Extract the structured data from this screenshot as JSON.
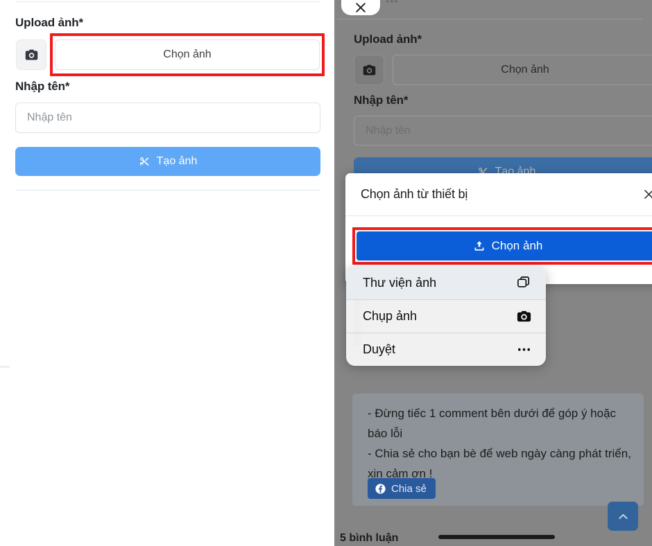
{
  "left_panel": {
    "upload_label": "Upload ảnh*",
    "camera_icon": "camera-icon",
    "choose_image_label": "Chọn ảnh",
    "name_label": "Nhập tên*",
    "name_placeholder": "Nhập tên",
    "create_button_label": "Tạo ảnh",
    "create_button_icon": "scissors-icon",
    "create_button_color": "#5fa8f7",
    "highlight_color": "#f01c1c"
  },
  "right_panel": {
    "close_pill_icon": "close-x-icon",
    "overflow_dots": "•••",
    "upload_label": "Upload ảnh*",
    "camera_icon": "camera-icon",
    "choose_image_label": "Chọn ảnh",
    "name_label": "Nhập tên*",
    "name_placeholder": "Nhập tên",
    "create_button_label": "Tạo ảnh",
    "create_button_icon": "scissors-icon",
    "scrim_color": "#858585"
  },
  "modal": {
    "title": "Chọn ảnh từ thiết bị",
    "close_icon": "close-x-icon",
    "upload_button_label": "Chọn ảnh",
    "upload_button_icon": "upload-icon",
    "upload_button_color": "#0b5ed7",
    "highlight_color": "#f01c1c"
  },
  "action_sheet": {
    "items": [
      {
        "label": "Thư viện ảnh",
        "icon": "photo-library-icon",
        "selected": true
      },
      {
        "label": "Chụp ảnh",
        "icon": "camera-icon",
        "selected": false
      },
      {
        "label": "Duyệt",
        "icon": "ellipsis-icon",
        "selected": false
      }
    ]
  },
  "note_card": {
    "line1": "- Đừng tiếc 1 comment bên dưới để góp ý hoặc báo lỗi",
    "line2": "- Chia sẻ cho bạn bè để web ngày càng phát triển, xin cảm ơn !",
    "share_button_label": "Chia sẻ",
    "share_button_icon": "facebook-icon",
    "share_button_color": "#2a5a9e"
  },
  "footer": {
    "comments_label": "5 bình luận",
    "scroll_top_icon": "chevron-up-icon"
  }
}
